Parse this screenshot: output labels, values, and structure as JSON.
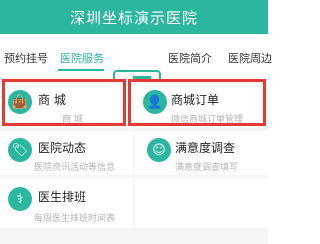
{
  "header": {
    "title": "深圳坐标演示医院"
  },
  "tabs": [
    {
      "label": "预约挂号"
    },
    {
      "label": "医院服务"
    },
    {
      "label": "医院简介"
    },
    {
      "label": "医院周边"
    }
  ],
  "accent_color": "#2bb6a0",
  "highlight_color": "#e53935",
  "menu": [
    {
      "title": "商 城",
      "subtitle": "商 城",
      "icon": "bag-icon"
    },
    {
      "title": "商城订单",
      "subtitle": "微信商城订单管理",
      "icon": "user-icon"
    },
    {
      "title": "医院动态",
      "subtitle": "医院资讯活动等信息",
      "icon": "tag-icon"
    },
    {
      "title": "满意度调查",
      "subtitle": "满意度调查填写",
      "icon": "smile-icon"
    },
    {
      "title": "医生排班",
      "subtitle": "每周医生排班时间表",
      "icon": "doctor-icon"
    }
  ]
}
